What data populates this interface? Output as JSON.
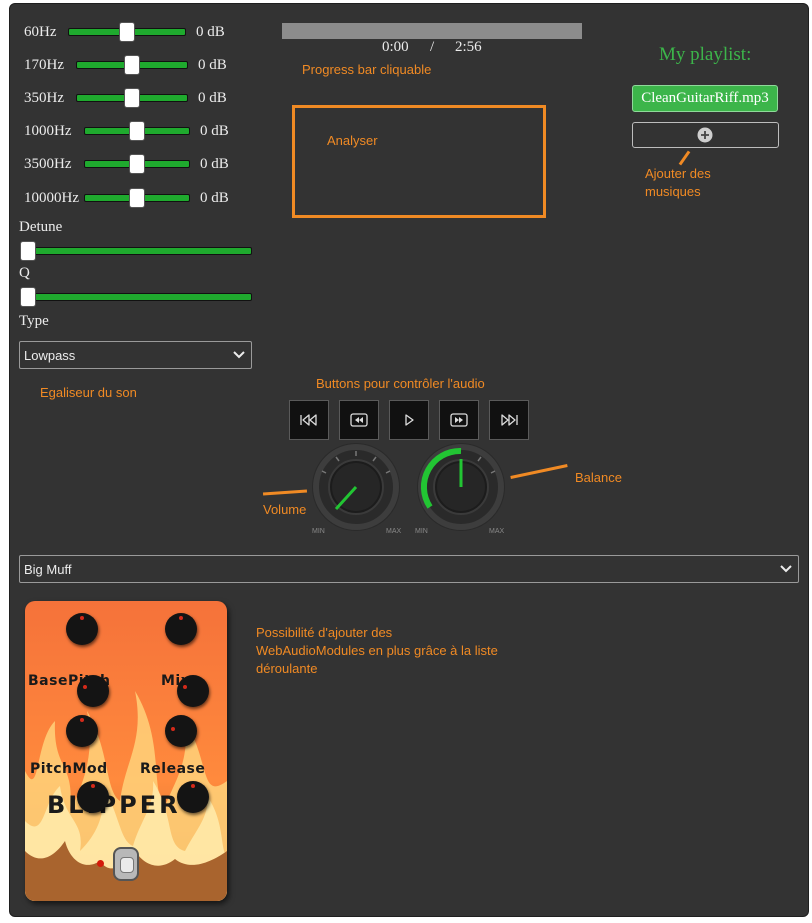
{
  "equalizer": {
    "bands": [
      {
        "label": "60Hz",
        "value": "0 dB"
      },
      {
        "label": "170Hz",
        "value": "0 dB"
      },
      {
        "label": "350Hz",
        "value": "0 dB"
      },
      {
        "label": "1000Hz",
        "value": "0 dB"
      },
      {
        "label": "3500Hz",
        "value": "0 dB"
      },
      {
        "label": "10000Hz",
        "value": "0 dB"
      }
    ],
    "detune_label": "Detune",
    "q_label": "Q",
    "type_label": "Type",
    "type_selected": "Lowpass",
    "annotation": "Egaliseur du son"
  },
  "player": {
    "current_time": "0:00",
    "separator": "/",
    "duration": "2:56",
    "progress_annotation": "Progress bar cliquable",
    "progress": 0.0,
    "analyser_label": "Analyser",
    "buttons_annotation": "Buttons pour contrôler l'audio",
    "volume_annotation": "Volume",
    "balance_annotation": "Balance",
    "knob_min": "MIN",
    "knob_max": "MAX"
  },
  "playlist": {
    "title": "My playlist:",
    "tracks": [
      "CleanGuitarRiff.mp3"
    ],
    "add_annotation_line1": "Ajouter des",
    "add_annotation_line2": "musiques"
  },
  "wam": {
    "selected": "Big Muff",
    "annotation_line1": "Possibilité d'ajouter des",
    "annotation_line2": "WebAudioModules en plus grâce à la liste",
    "annotation_line3": "déroulante",
    "pedal": {
      "label_basepitch": "BasePitch",
      "label_mix": "Mix",
      "label_pitchmod": "PitchMod",
      "label_release": "Release",
      "name": "BLIPPER"
    }
  },
  "colors": {
    "panel_bg": "#333333",
    "accent_green": "#1faa2e",
    "annotation_orange": "#f08a24",
    "playlist_green": "#3cb54a"
  }
}
